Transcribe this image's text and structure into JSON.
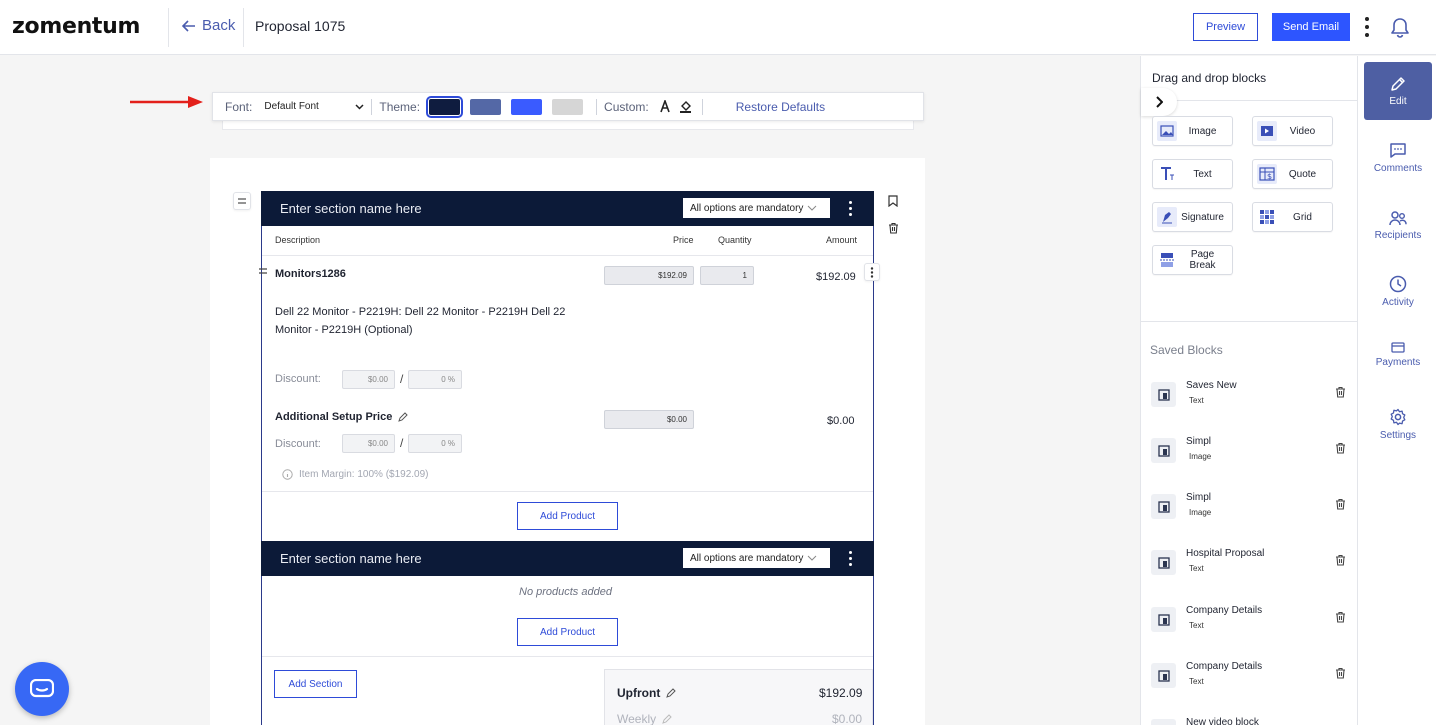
{
  "header": {
    "logo": "zomentum",
    "back_label": "Back",
    "title": "Proposal 1075",
    "preview_label": "Preview",
    "send_label": "Send Email"
  },
  "toolbar": {
    "font_label": "Font:",
    "font_value": "Default Font",
    "theme_label": "Theme:",
    "theme_swatches": [
      "#0f1c3f",
      "#5468a6",
      "#3a5bff",
      "#d6d6d6"
    ],
    "custom_label": "Custom:",
    "restore_label": "Restore Defaults"
  },
  "sections": [
    {
      "name_placeholder": "Enter section name here",
      "mandatory_label": "All options are mandatory",
      "columns": [
        "Description",
        "Price",
        "Quantity",
        "Amount"
      ],
      "products": [
        {
          "name": "Monitors1286",
          "price": "$192.09",
          "quantity": "1",
          "amount": "$192.09",
          "description": "Dell 22 Monitor - P2219H: Dell 22 Monitor - P2219H Dell 22 Monitor - P2219H (Optional)",
          "discount_label": "Discount:",
          "discount_amount": "$0.00",
          "discount_sep": "/",
          "discount_percent": "0 %"
        },
        {
          "name": "Additional Setup Price",
          "price": "$0.00",
          "amount": "$0.00",
          "discount_label": "Discount:",
          "discount_amount": "$0.00",
          "discount_sep": "/",
          "discount_percent": "0 %"
        }
      ],
      "margin_text": "Item Margin: 100% ($192.09)",
      "add_product_label": "Add Product"
    },
    {
      "name_placeholder": "Enter section name here",
      "mandatory_label": "All options are mandatory",
      "empty_text": "No products added",
      "add_product_label": "Add Product"
    }
  ],
  "add_section_label": "Add Section",
  "summary": [
    {
      "label": "Upfront",
      "value": "$192.09"
    },
    {
      "label": "Weekly",
      "value": "$0.00"
    }
  ],
  "blocks_panel": {
    "title": "Drag and drop blocks",
    "blocks": [
      {
        "label": "Image",
        "icon": "image-icon"
      },
      {
        "label": "Video",
        "icon": "video-icon"
      },
      {
        "label": "Text",
        "icon": "text-icon"
      },
      {
        "label": "Quote",
        "icon": "quote-icon"
      },
      {
        "label": "Signature",
        "icon": "signature-icon"
      },
      {
        "label": "Grid",
        "icon": "grid-icon"
      },
      {
        "label": "Page Break",
        "icon": "page-break-icon"
      }
    ],
    "saved_title": "Saved Blocks",
    "saved": [
      {
        "name": "Saves New",
        "type": "Text"
      },
      {
        "name": "Simpl",
        "type": "Image"
      },
      {
        "name": "Simpl",
        "type": "Image"
      },
      {
        "name": "Hospital Proposal",
        "type": "Text"
      },
      {
        "name": "Company Details",
        "type": "Text"
      },
      {
        "name": "Company Details",
        "type": "Text"
      },
      {
        "name": "New video block",
        "type": ""
      }
    ]
  },
  "right_nav": [
    {
      "label": "Edit",
      "icon": "pencil-icon",
      "active": true
    },
    {
      "label": "Comments",
      "icon": "comment-icon"
    },
    {
      "label": "Recipients",
      "icon": "people-icon"
    },
    {
      "label": "Activity",
      "icon": "clock-icon"
    },
    {
      "label": "Payments",
      "icon": "card-icon"
    },
    {
      "label": "Settings",
      "icon": "gear-icon"
    }
  ]
}
